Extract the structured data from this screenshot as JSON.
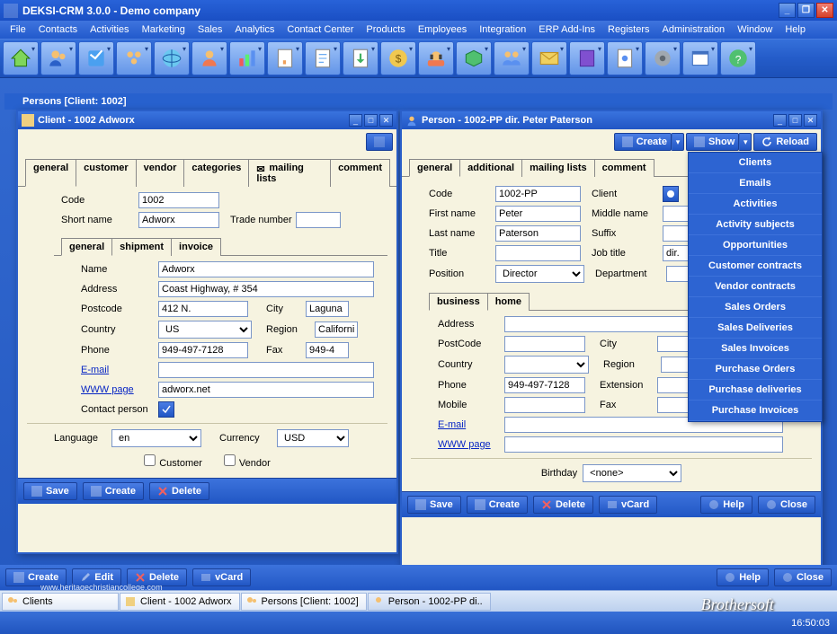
{
  "app": {
    "title": "DEKSI-CRM 3.0.0 - Demo company"
  },
  "menubar": [
    "File",
    "Contacts",
    "Activities",
    "Marketing",
    "Sales",
    "Analytics",
    "Contact Center",
    "Products",
    "Employees",
    "Integration",
    "ERP Add-Ins",
    "Registers",
    "Administration",
    "Window",
    "Help"
  ],
  "docbar": "Persons [Client: 1002]",
  "client_win": {
    "title": "Client - 1002 Adworx",
    "tabs": [
      "general",
      "customer",
      "vendor",
      "categories",
      "mailing lists",
      "comment"
    ],
    "code_label": "Code",
    "code": "1002",
    "shortname_label": "Short name",
    "shortname": "Adworx",
    "tradenumber_label": "Trade number",
    "tradenumber": "",
    "subtabs": [
      "general",
      "shipment",
      "invoice"
    ],
    "name_label": "Name",
    "name": "Adworx",
    "address_label": "Address",
    "address": "Coast Highway, # 354",
    "postcode_label": "Postcode",
    "postcode": "412 N.",
    "city_label": "City",
    "city": "Laguna",
    "country_label": "Country",
    "country": "US",
    "region_label": "Region",
    "region": "California",
    "phone_label": "Phone",
    "phone": "949-497-7128",
    "fax_label": "Fax",
    "fax": "949-4",
    "email_label": "E-mail",
    "email": "",
    "www_label": "WWW page",
    "www": "adworx.net",
    "contactperson_label": "Contact person",
    "language_label": "Language",
    "language": "en",
    "currency_label": "Currency",
    "currency": "USD",
    "customer_chk": "Customer",
    "vendor_chk": "Vendor",
    "buttons": {
      "save": "Save",
      "create": "Create",
      "delete": "Delete"
    }
  },
  "person_win": {
    "title": "Person - 1002-PP dir. Peter Paterson",
    "toolbar": {
      "create": "Create",
      "show": "Show",
      "reload": "Reload"
    },
    "tabs": [
      "general",
      "additional",
      "mailing lists",
      "comment"
    ],
    "code_label": "Code",
    "code": "1002-PP",
    "client_label": "Client",
    "firstname_label": "First name",
    "firstname": "Peter",
    "middlename_label": "Middle name",
    "lastname_label": "Last name",
    "lastname": "Paterson",
    "suffix_label": "Suffix",
    "title_label": "Title",
    "title_val": "",
    "jobtitle_label": "Job title",
    "jobtitle": "dir.",
    "position_label": "Position",
    "position": "Director",
    "department_label": "Department",
    "subtabs": [
      "business",
      "home"
    ],
    "address_label": "Address",
    "postcode_label": "PostCode",
    "city_label": "City",
    "country_label": "Country",
    "region_label": "Region",
    "phone_label": "Phone",
    "phone": "949-497-7128",
    "extension_label": "Extension",
    "mobile_label": "Mobile",
    "fax_label": "Fax",
    "email_label": "E-mail",
    "www_label": "WWW page",
    "birthday_label": "Birthday",
    "birthday": "<none>",
    "buttons": {
      "save": "Save",
      "create": "Create",
      "delete": "Delete",
      "vcard": "vCard",
      "help": "Help",
      "close": "Close"
    }
  },
  "show_menu": [
    "Clients",
    "Emails",
    "Activities",
    "Activity subjects",
    "Opportunities",
    "Customer contracts",
    "Vendor contracts",
    "Sales Orders",
    "Sales Deliveries",
    "Sales Invoices",
    "Purchase Orders",
    "Purchase deliveries",
    "Purchase Invoices"
  ],
  "main_footer": {
    "create": "Create",
    "edit": "Edit",
    "delete": "Delete",
    "vcard": "vCard",
    "help": "Help",
    "close": "Close"
  },
  "taskbar": [
    {
      "label": "Clients"
    },
    {
      "label": "Client - 1002 Adworx"
    },
    {
      "label": "Persons [Client: 1002]"
    },
    {
      "label": "Person - 1002-PP di.."
    }
  ],
  "statusbar": {
    "time": "16:50:03"
  },
  "watermark": "www.heritagechristiancollege.com",
  "brand": "Brothersoft"
}
